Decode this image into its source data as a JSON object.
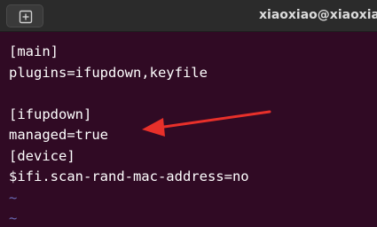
{
  "window": {
    "title": "xiaoxiao@xiaoxiao"
  },
  "toolbar": {
    "new_tab_icon": "new-tab-icon"
  },
  "terminal": {
    "lines": [
      "[main]",
      "plugins=ifupdown,keyfile",
      "",
      "[ifupdown]",
      "managed=true",
      "[device]",
      "$ifi.scan-rand-mac-address=no",
      "~",
      "~"
    ]
  },
  "annotation": {
    "arrow_color": "#e8302a"
  },
  "colors": {
    "background": "#300a24",
    "titlebar": "#2b2b2b",
    "text": "#ffffff",
    "tilde": "#6a6ab4"
  }
}
